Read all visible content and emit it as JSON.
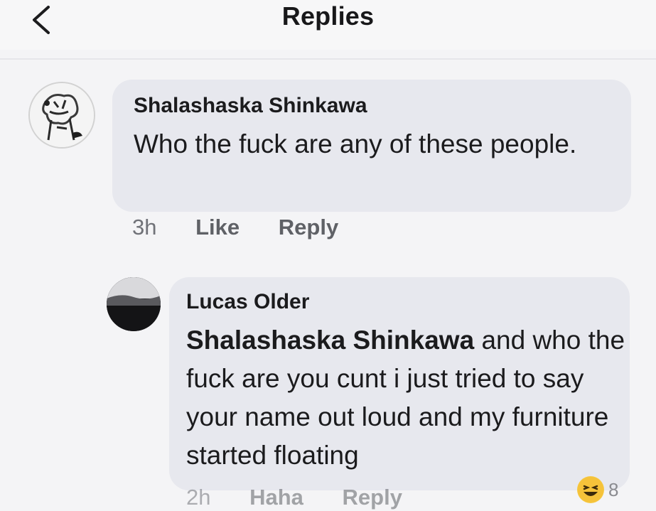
{
  "header": {
    "title": "Replies",
    "back_icon": "chevron-left-icon"
  },
  "comments": [
    {
      "author": "Shalashaska Shinkawa",
      "text": "Who the fuck are any of these people.",
      "time": "3h",
      "actions": [
        "Like",
        "Reply"
      ],
      "avatar_icon": "sketch-drawing-avatar"
    },
    {
      "author": "Lucas Older",
      "mention": "Shalashaska Shinkawa",
      "text": " and who the fuck are you cunt i just tried to say your name out loud and my furniture started floating",
      "time": "2h",
      "actions": [
        "Haha",
        "Reply"
      ],
      "avatar_icon": "dark-landscape-avatar",
      "reaction": {
        "icon": "haha-emoji-icon",
        "count": "8"
      }
    }
  ],
  "colors": {
    "bubble": "#e7e8ee",
    "background": "#f4f4f6",
    "meta_text": "#707278",
    "reaction": "#f7c83f"
  }
}
